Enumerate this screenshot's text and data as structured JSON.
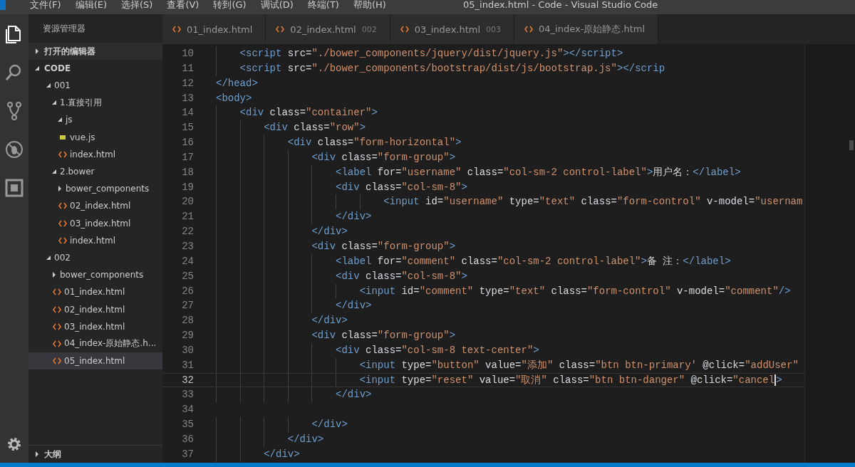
{
  "window": {
    "title": "05_index.html - Code - Visual Studio Code"
  },
  "menu": [
    "文件(F)",
    "编辑(E)",
    "选择(S)",
    "查看(V)",
    "转到(G)",
    "调试(D)",
    "终端(T)",
    "帮助(H)"
  ],
  "activity_bar": [
    {
      "kind": "files",
      "selected": true
    },
    {
      "kind": "search",
      "selected": false
    },
    {
      "kind": "source-control",
      "selected": false
    },
    {
      "kind": "debug",
      "selected": false
    },
    {
      "kind": "extensions",
      "selected": false
    }
  ],
  "sidebar": {
    "title": "资源管理器",
    "sections": [
      {
        "label": "打开的编辑器",
        "expanded": false
      },
      {
        "label": "CODE",
        "expanded": true
      }
    ],
    "tree": [
      {
        "label": "001",
        "kind": "folder",
        "expanded": true,
        "selected": false,
        "children": [
          {
            "label": "1.直接引用",
            "kind": "folder",
            "expanded": true,
            "selected": false,
            "children": [
              {
                "label": "js",
                "kind": "folder",
                "expanded": true,
                "selected": false,
                "children": [
                  {
                    "label": "vue.js",
                    "kind": "js",
                    "selected": false
                  }
                ]
              },
              {
                "label": "index.html",
                "kind": "html",
                "selected": false
              }
            ]
          },
          {
            "label": "2.bower",
            "kind": "folder",
            "expanded": true,
            "selected": false,
            "children": [
              {
                "label": "bower_components",
                "kind": "folder",
                "expanded": false,
                "selected": false
              },
              {
                "label": "02_index.html",
                "kind": "html",
                "selected": false
              },
              {
                "label": "03_index.html",
                "kind": "html",
                "selected": false
              },
              {
                "label": "index.html",
                "kind": "html",
                "selected": false
              }
            ]
          }
        ]
      },
      {
        "label": "002",
        "kind": "folder",
        "expanded": true,
        "selected": false,
        "children": [
          {
            "label": "bower_components",
            "kind": "folder",
            "expanded": false,
            "selected": false
          },
          {
            "label": "01_index.html",
            "kind": "html",
            "selected": false
          },
          {
            "label": "02_index.html",
            "kind": "html",
            "selected": false
          },
          {
            "label": "03_index.html",
            "kind": "html",
            "selected": false
          },
          {
            "label": "04_index-原始静态.h...",
            "kind": "html",
            "selected": false
          },
          {
            "label": "05_index.html",
            "kind": "html",
            "selected": true
          }
        ]
      }
    ],
    "outline": {
      "label": "大纲",
      "expanded": false
    }
  },
  "tabs": [
    {
      "label": "01_index.html",
      "selected": false
    },
    {
      "label": "02_index.html",
      "description": "002",
      "selected": false
    },
    {
      "label": "03_index.html",
      "description": "003",
      "selected": false
    },
    {
      "label": "04_index-原始静态.html",
      "selected": false
    }
  ],
  "editor": {
    "lines": [
      {
        "number": "10",
        "current": false,
        "tokens": [
          {
            "kind": "tag",
            "text": "    <script"
          },
          {
            "kind": "attr",
            "text": " src="
          },
          {
            "kind": "string",
            "text": "\"./bower_components/jquery/dist/jquery.js\""
          },
          {
            "kind": "tag",
            "text": "></script>"
          }
        ]
      },
      {
        "number": "11",
        "current": false,
        "tokens": [
          {
            "kind": "tag",
            "text": "    <script"
          },
          {
            "kind": "attr",
            "text": " src="
          },
          {
            "kind": "string",
            "text": "\"./bower_components/bootstrap/dist/js/bootstrap.js\""
          },
          {
            "kind": "tag",
            "text": "></scrip"
          }
        ]
      },
      {
        "number": "12",
        "current": false,
        "tokens": [
          {
            "kind": "tag",
            "text": "</head>"
          }
        ]
      },
      {
        "number": "13",
        "current": false,
        "tokens": [
          {
            "kind": "tag",
            "text": "<body>"
          }
        ]
      },
      {
        "number": "14",
        "current": false,
        "tokens": [
          {
            "kind": "tag",
            "text": "    <div"
          },
          {
            "kind": "attr",
            "text": " class="
          },
          {
            "kind": "string",
            "text": "\"container\""
          },
          {
            "kind": "tag",
            "text": ">"
          }
        ]
      },
      {
        "number": "15",
        "current": false,
        "tokens": [
          {
            "kind": "tag",
            "text": "        <div"
          },
          {
            "kind": "attr",
            "text": " class="
          },
          {
            "kind": "string",
            "text": "\"row\""
          },
          {
            "kind": "tag",
            "text": ">"
          }
        ]
      },
      {
        "number": "16",
        "current": false,
        "tokens": [
          {
            "kind": "tag",
            "text": "            <div"
          },
          {
            "kind": "attr",
            "text": " class="
          },
          {
            "kind": "string",
            "text": "\"form-horizontal\""
          },
          {
            "kind": "tag",
            "text": ">"
          }
        ]
      },
      {
        "number": "17",
        "current": false,
        "tokens": [
          {
            "kind": "tag",
            "text": "                <div"
          },
          {
            "kind": "attr",
            "text": " class="
          },
          {
            "kind": "string",
            "text": "\"form-group\""
          },
          {
            "kind": "tag",
            "text": ">"
          }
        ]
      },
      {
        "number": "18",
        "current": false,
        "tokens": [
          {
            "kind": "tag",
            "text": "                    <label"
          },
          {
            "kind": "attr",
            "text": " for="
          },
          {
            "kind": "string",
            "text": "\"username\""
          },
          {
            "kind": "attr",
            "text": " class="
          },
          {
            "kind": "string",
            "text": "\"col-sm-2 control-label\""
          },
          {
            "kind": "tag",
            "text": ">"
          },
          {
            "kind": "text",
            "text": "用户名："
          },
          {
            "kind": "tag",
            "text": "</label>"
          }
        ]
      },
      {
        "number": "19",
        "current": false,
        "tokens": [
          {
            "kind": "tag",
            "text": "                    <div"
          },
          {
            "kind": "attr",
            "text": " class="
          },
          {
            "kind": "string",
            "text": "\"col-sm-8\""
          },
          {
            "kind": "tag",
            "text": ">"
          }
        ]
      },
      {
        "number": "20",
        "current": false,
        "tokens": [
          {
            "kind": "tag",
            "text": "                            <input"
          },
          {
            "kind": "attr",
            "text": " id="
          },
          {
            "kind": "string",
            "text": "\"username\""
          },
          {
            "kind": "attr",
            "text": " type="
          },
          {
            "kind": "string",
            "text": "\"text\""
          },
          {
            "kind": "attr",
            "text": " class="
          },
          {
            "kind": "string",
            "text": "\"form-control\""
          },
          {
            "kind": "attr",
            "text": " v-model="
          },
          {
            "kind": "string",
            "text": "\"usernam"
          }
        ]
      },
      {
        "number": "21",
        "current": false,
        "tokens": [
          {
            "kind": "tag",
            "text": "                    </div>"
          }
        ]
      },
      {
        "number": "22",
        "current": false,
        "tokens": [
          {
            "kind": "tag",
            "text": "                </div>"
          }
        ]
      },
      {
        "number": "23",
        "current": false,
        "tokens": [
          {
            "kind": "tag",
            "text": "                <div"
          },
          {
            "kind": "attr",
            "text": " class="
          },
          {
            "kind": "string",
            "text": "\"form-group\""
          },
          {
            "kind": "tag",
            "text": ">"
          }
        ]
      },
      {
        "number": "24",
        "current": false,
        "tokens": [
          {
            "kind": "tag",
            "text": "                    <label"
          },
          {
            "kind": "attr",
            "text": " for="
          },
          {
            "kind": "string",
            "text": "\"comment\""
          },
          {
            "kind": "attr",
            "text": " class="
          },
          {
            "kind": "string",
            "text": "\"col-sm-2 control-label\""
          },
          {
            "kind": "tag",
            "text": ">"
          },
          {
            "kind": "text",
            "text": "备 注："
          },
          {
            "kind": "tag",
            "text": "</label>"
          }
        ]
      },
      {
        "number": "25",
        "current": false,
        "tokens": [
          {
            "kind": "tag",
            "text": "                    <div"
          },
          {
            "kind": "attr",
            "text": " class="
          },
          {
            "kind": "string",
            "text": "\"col-sm-8\""
          },
          {
            "kind": "tag",
            "text": ">"
          }
        ]
      },
      {
        "number": "26",
        "current": false,
        "tokens": [
          {
            "kind": "tag",
            "text": "                        <input"
          },
          {
            "kind": "attr",
            "text": " id="
          },
          {
            "kind": "string",
            "text": "\"comment\""
          },
          {
            "kind": "attr",
            "text": " type="
          },
          {
            "kind": "string",
            "text": "\"text\""
          },
          {
            "kind": "attr",
            "text": " class="
          },
          {
            "kind": "string",
            "text": "\"form-control\""
          },
          {
            "kind": "attr",
            "text": " v-model="
          },
          {
            "kind": "string",
            "text": "\"comment\""
          },
          {
            "kind": "tag",
            "text": "/>"
          }
        ]
      },
      {
        "number": "27",
        "current": false,
        "tokens": [
          {
            "kind": "tag",
            "text": "                    </div>"
          }
        ]
      },
      {
        "number": "28",
        "current": false,
        "tokens": [
          {
            "kind": "tag",
            "text": "                </div>"
          }
        ]
      },
      {
        "number": "29",
        "current": false,
        "tokens": [
          {
            "kind": "tag",
            "text": "                <div"
          },
          {
            "kind": "attr",
            "text": " class="
          },
          {
            "kind": "string",
            "text": "\"form-group\""
          },
          {
            "kind": "tag",
            "text": ">"
          }
        ]
      },
      {
        "number": "30",
        "current": false,
        "tokens": [
          {
            "kind": "tag",
            "text": "                    <div"
          },
          {
            "kind": "attr",
            "text": " class="
          },
          {
            "kind": "string",
            "text": "\"col-sm-8 text-center\""
          },
          {
            "kind": "tag",
            "text": ">"
          }
        ]
      },
      {
        "number": "31",
        "current": false,
        "tokens": [
          {
            "kind": "tag",
            "text": "                        <input"
          },
          {
            "kind": "attr",
            "text": " type="
          },
          {
            "kind": "string",
            "text": "\"button\""
          },
          {
            "kind": "attr",
            "text": " value="
          },
          {
            "kind": "string",
            "text": "\"添加\""
          },
          {
            "kind": "attr",
            "text": " class="
          },
          {
            "kind": "string",
            "text": "\"btn btn-primary'"
          },
          {
            "kind": "attr",
            "text": " @click="
          },
          {
            "kind": "string",
            "text": "\"addUser\""
          }
        ]
      },
      {
        "number": "32",
        "current": true,
        "tokens": [
          {
            "kind": "tag",
            "text": "                        <input"
          },
          {
            "kind": "attr",
            "text": " type="
          },
          {
            "kind": "string",
            "text": "\"reset\""
          },
          {
            "kind": "attr",
            "text": " value="
          },
          {
            "kind": "string",
            "text": "\"取消\""
          },
          {
            "kind": "attr",
            "text": " class="
          },
          {
            "kind": "string",
            "text": "\"btn btn-danger\""
          },
          {
            "kind": "attr",
            "text": " @click="
          },
          {
            "kind": "string",
            "text": "\"cancel"
          },
          {
            "kind": "tag",
            "text": ">"
          }
        ]
      },
      {
        "number": "33",
        "current": false,
        "tokens": [
          {
            "kind": "tag",
            "text": "                    </div>"
          }
        ]
      },
      {
        "number": "34",
        "current": false
      },
      {
        "number": "35",
        "current": false,
        "tokens": [
          {
            "kind": "tag",
            "text": "                </div>"
          }
        ]
      },
      {
        "number": "36",
        "current": false,
        "tokens": [
          {
            "kind": "tag",
            "text": "            </div>"
          }
        ]
      },
      {
        "number": "37",
        "current": false,
        "tokens": [
          {
            "kind": "tag",
            "text": "        </div>"
          }
        ]
      }
    ]
  }
}
